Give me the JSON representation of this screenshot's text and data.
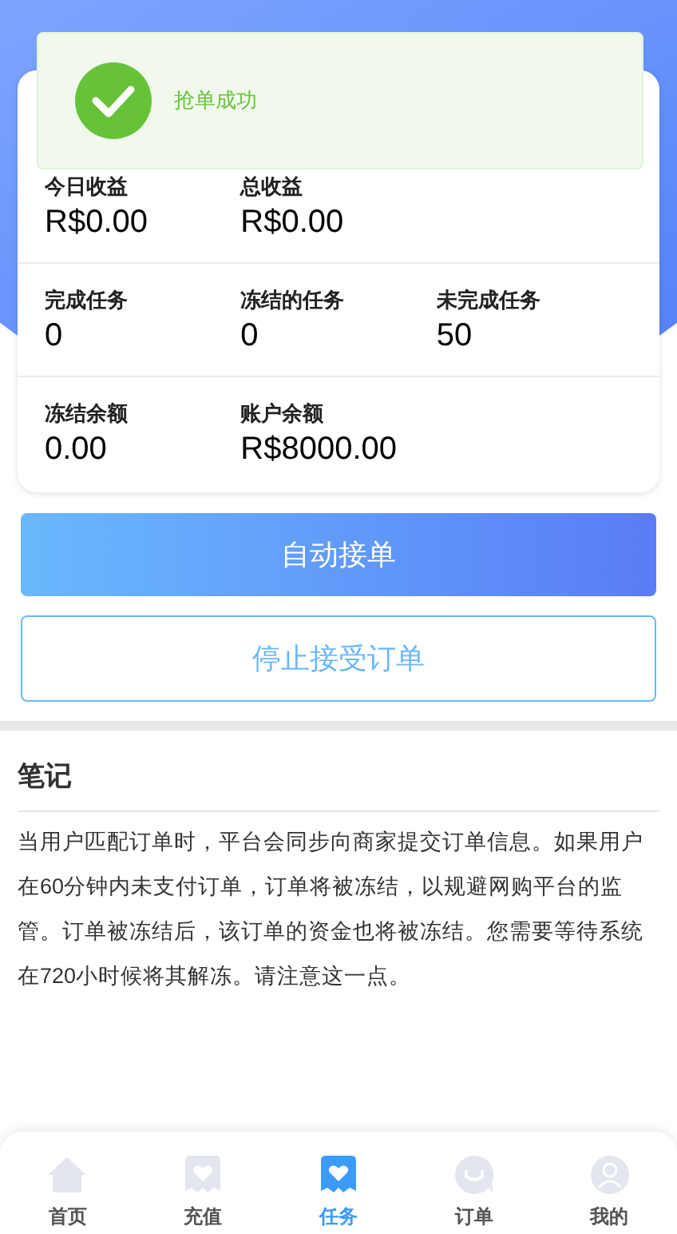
{
  "toast": {
    "message": "抢单成功"
  },
  "stats": [
    [
      {
        "label": "今日收益",
        "value": "R$0.00"
      },
      {
        "label": "总收益",
        "value": "R$0.00"
      }
    ],
    [
      {
        "label": "完成任务",
        "value": "0"
      },
      {
        "label": "冻结的任务",
        "value": "0"
      },
      {
        "label": "未完成任务",
        "value": "50"
      }
    ],
    [
      {
        "label": "冻结余额",
        "value": "0.00"
      },
      {
        "label": "账户余额",
        "value": "R$8000.00"
      }
    ]
  ],
  "buttons": {
    "primary": "自动接单",
    "secondary": "停止接受订单"
  },
  "notes": {
    "title": "笔记",
    "body": "当用户匹配订单时，平台会同步向商家提交订单信息。如果用户在60分钟内未支付订单，订单将被冻结，以规避网购平台的监管。订单被冻结后，该订单的资金也将被冻结。您需要等待系统在720小时候将其解冻。请注意这一点。"
  },
  "nav": [
    {
      "label": "首页",
      "selected": false
    },
    {
      "label": "充值",
      "selected": false
    },
    {
      "label": "任务",
      "selected": true
    },
    {
      "label": "订单",
      "selected": false
    },
    {
      "label": "我的",
      "selected": false
    }
  ]
}
